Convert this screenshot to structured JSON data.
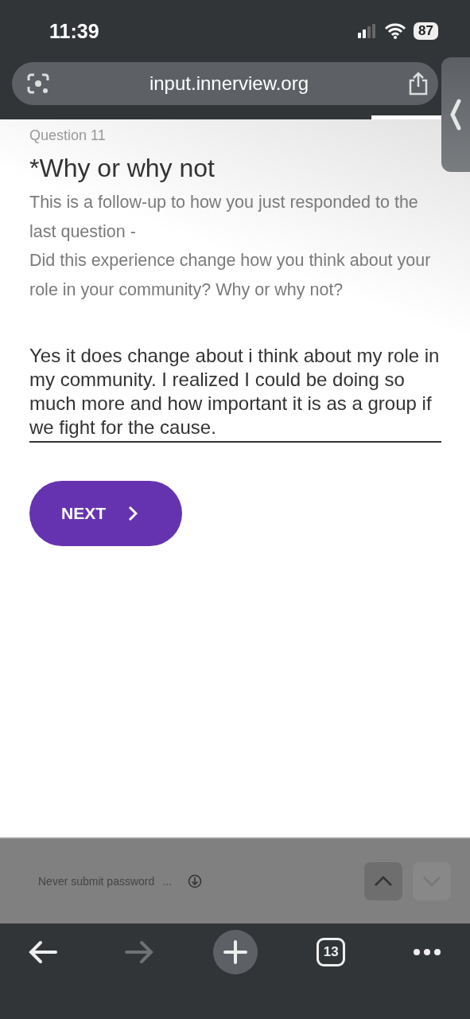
{
  "status_bar": {
    "time": "11:39",
    "battery": "87"
  },
  "address_bar": {
    "url": "input.innerview.org"
  },
  "page_progress": {
    "level": 0.79
  },
  "question": {
    "label": "Question 11",
    "title": "*Why or why not",
    "description": [
      "This is a follow-up to how you just responded to the last question -",
      "Did this experience change how you think about your role in your community? Why or why not?"
    ]
  },
  "answer": {
    "value": "Yes it does change about i think about my role in my community. I realized I could be doing so much more and how important it is as a group if we fight for the cause."
  },
  "next_button": {
    "label": "NEXT"
  },
  "form_toolbar": {
    "text": "Never submit password",
    "ellipsis": "...",
    "previous_disabled": false,
    "next_disabled": true
  },
  "browser_toolbar": {
    "back_disabled": false,
    "forward_disabled": true,
    "tab_count": "13"
  }
}
